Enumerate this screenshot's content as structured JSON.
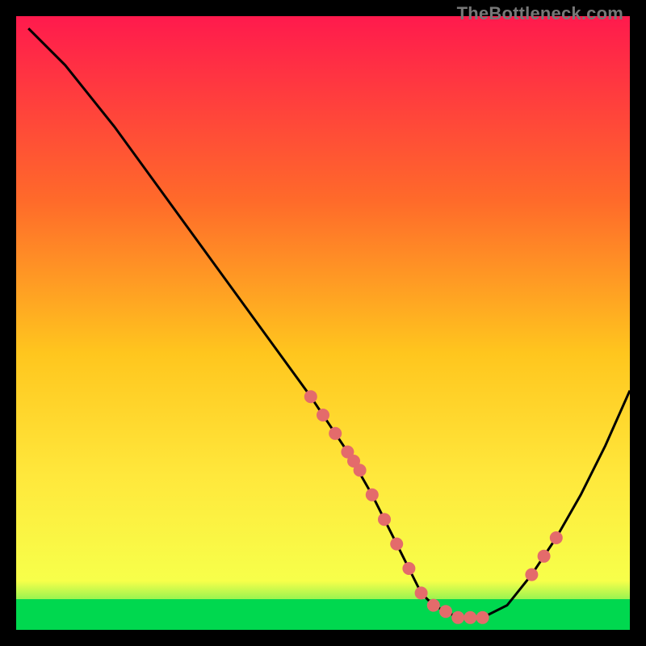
{
  "watermark": "TheBottleneck.com",
  "chart_data": {
    "type": "line",
    "title": "",
    "xlabel": "",
    "ylabel": "",
    "xlim": [
      0,
      100
    ],
    "ylim": [
      0,
      100
    ],
    "grid": false,
    "green_band": {
      "ymin": 0,
      "ymax": 5
    },
    "gradient_stops": [
      {
        "offset": 0,
        "color": "#ff1a4d"
      },
      {
        "offset": 30,
        "color": "#ff6a2a"
      },
      {
        "offset": 55,
        "color": "#ffc61e"
      },
      {
        "offset": 75,
        "color": "#ffe83c"
      },
      {
        "offset": 92,
        "color": "#f7ff4a"
      },
      {
        "offset": 100,
        "color": "#00e05a"
      }
    ],
    "series": [
      {
        "name": "bottleneck-curve",
        "x": [
          2,
          8,
          16,
          24,
          32,
          40,
          48,
          54,
          58,
          62,
          64,
          66,
          68,
          70,
          72,
          76,
          80,
          84,
          88,
          92,
          96,
          100
        ],
        "y": [
          98,
          92,
          82,
          71,
          60,
          49,
          38,
          29,
          22,
          14,
          10,
          6,
          4,
          3,
          2,
          2,
          4,
          9,
          15,
          22,
          30,
          39
        ]
      }
    ],
    "points": {
      "name": "data-dots",
      "color": "#e46b6b",
      "r": 8,
      "x": [
        48,
        50,
        52,
        54,
        55,
        56,
        58,
        60,
        62,
        64,
        66,
        68,
        70,
        72,
        74,
        76,
        84,
        86,
        88
      ],
      "y": [
        38,
        35,
        32,
        29,
        27.5,
        26,
        22,
        18,
        14,
        10,
        6,
        4,
        3,
        2,
        2,
        2,
        9,
        12,
        15
      ]
    }
  }
}
